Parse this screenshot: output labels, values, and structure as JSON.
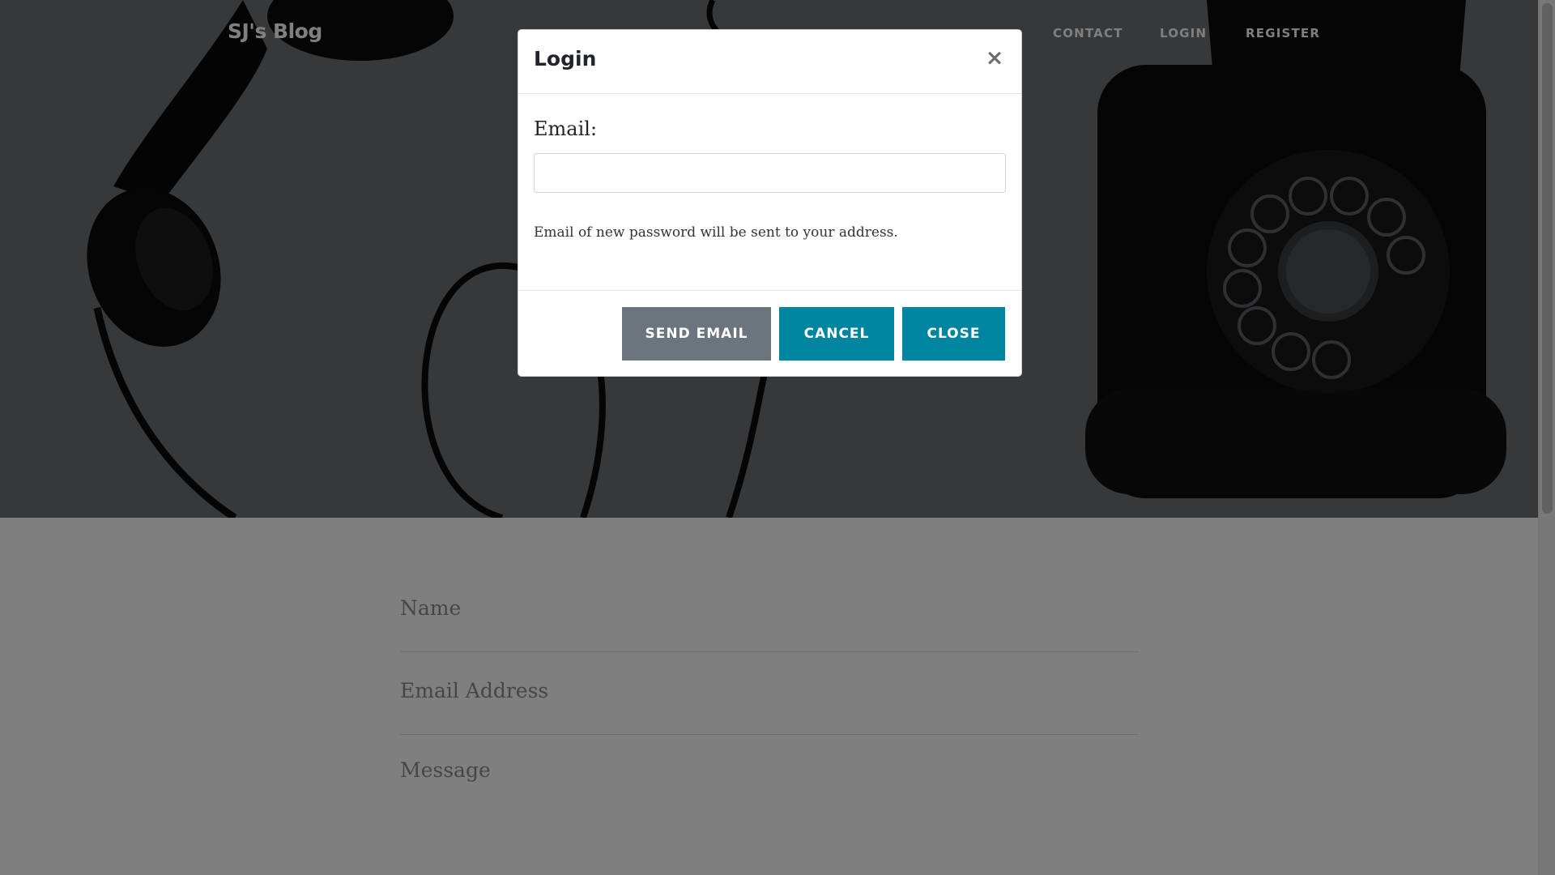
{
  "navbar": {
    "brand": "SJ's Blog",
    "links": [
      "CONTACT",
      "LOGIN",
      "REGISTER"
    ]
  },
  "contact_form": {
    "name_placeholder": "Name",
    "email_placeholder": "Email Address",
    "message_placeholder": "Message"
  },
  "modal": {
    "title": "Login",
    "close_symbol": "×",
    "email_label": "Email:",
    "email_value": "",
    "help_text": "Email of new password will be sent to your address.",
    "buttons": {
      "send": "SEND EMAIL",
      "cancel": "CANCEL",
      "close": "CLOSE"
    }
  },
  "colors": {
    "accent": "#0085a1",
    "secondary": "#6c757d",
    "hero_bg": "#6e7174"
  }
}
